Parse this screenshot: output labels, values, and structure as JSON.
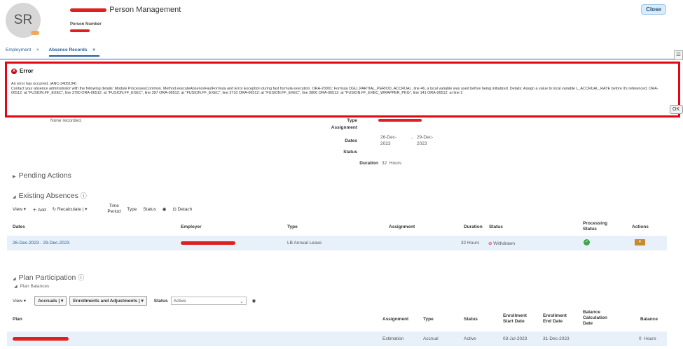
{
  "header": {
    "avatar_initials": "SR",
    "title": "Person Management",
    "person_number_label": "Person Number",
    "close_label": "Close"
  },
  "tabs": [
    {
      "label": "Employment"
    },
    {
      "label": "Absence Records"
    }
  ],
  "error": {
    "title": "Error",
    "message": "An error has occurred. (ANC-3405194)",
    "details": "Contact your absence administrator with the following details: Module ProcessesCommon. Method executeAbsenceFastFormula and Error Exception during fast formula execution. ORA-20001: Formula DGU_PARTIAL_PERIOD_ACCRUAL, line 46, a local variable was used before being initialized. Details: Assign a value to local variable L_ACCRUAL_RATE before it's referenced. ORA-06512: at \"FUSION.FF_EXEC\", line 3790 ORA-06512: at \"FUSION.FF_EXEC\", line 397 ORA-06512: at \"FUSION.FF_EXEC\", line 3710 ORA-06512: at \"FUSION.FF_EXEC\", line 3806 ORA-06512: at \"FUSION.FF_EXEC_WRAPPER_PKG\", line 141 ORA-06512: at line 2",
    "ok_label": "OK"
  },
  "summary": {
    "none_recorded": "None recorded.",
    "type_label": "Type",
    "assignment_label": "Assignment",
    "dates_label": "Dates",
    "date_start_day": "26-Dec-",
    "date_start_year": "2023",
    "date_end_day": "29-Dec-",
    "date_end_year": "2023",
    "date_separator": "-",
    "status_label": "Status",
    "duration_label": "Duration",
    "duration_value": "32",
    "duration_unit": "Hours"
  },
  "pending": {
    "title": "Pending Actions"
  },
  "existing": {
    "title": "Existing Absences",
    "toolbar": {
      "view": "View",
      "add": "Add",
      "recalculate": "Recalculate",
      "time_period_line1": "Time",
      "time_period_line2": "Period",
      "type": "Type",
      "status": "Status",
      "detach": "Detach"
    },
    "columns": [
      "Dates",
      "Employer",
      "Type",
      "Assignment",
      "Duration",
      "Status",
      "Processing Status",
      "Actions"
    ],
    "rows": [
      {
        "dates": "26-Dec-2023 - 29-Dec-2023",
        "type": "LB Annual Leave",
        "duration": "32",
        "duration_unit": "Hours",
        "status": "Withdrawn"
      }
    ]
  },
  "plan": {
    "title": "Plan Participation",
    "balances_title": "Plan Balances",
    "toolbar": {
      "view": "View",
      "accruals": "Accruals",
      "enrollments": "Enrollments and Adjustments",
      "status_label": "Status",
      "status_value": "Active"
    },
    "columns": [
      "Plan",
      "Assignment",
      "Type",
      "Status",
      "Enrollment Start Date",
      "Enrollment End Date",
      "Balance Calculation Date",
      "Balance"
    ],
    "rows": [
      {
        "assignment": "Estimation",
        "type": "Accrual",
        "status": "Active",
        "start": "03-Jul-2023",
        "end": "31-Dec-2023",
        "balance": "0",
        "balance_unit": "Hours"
      }
    ]
  },
  "colors": {
    "error_border": "#e30613",
    "link": "#1f5d99",
    "row_highlight": "#e8f1fa",
    "redaction": "#e02020"
  }
}
